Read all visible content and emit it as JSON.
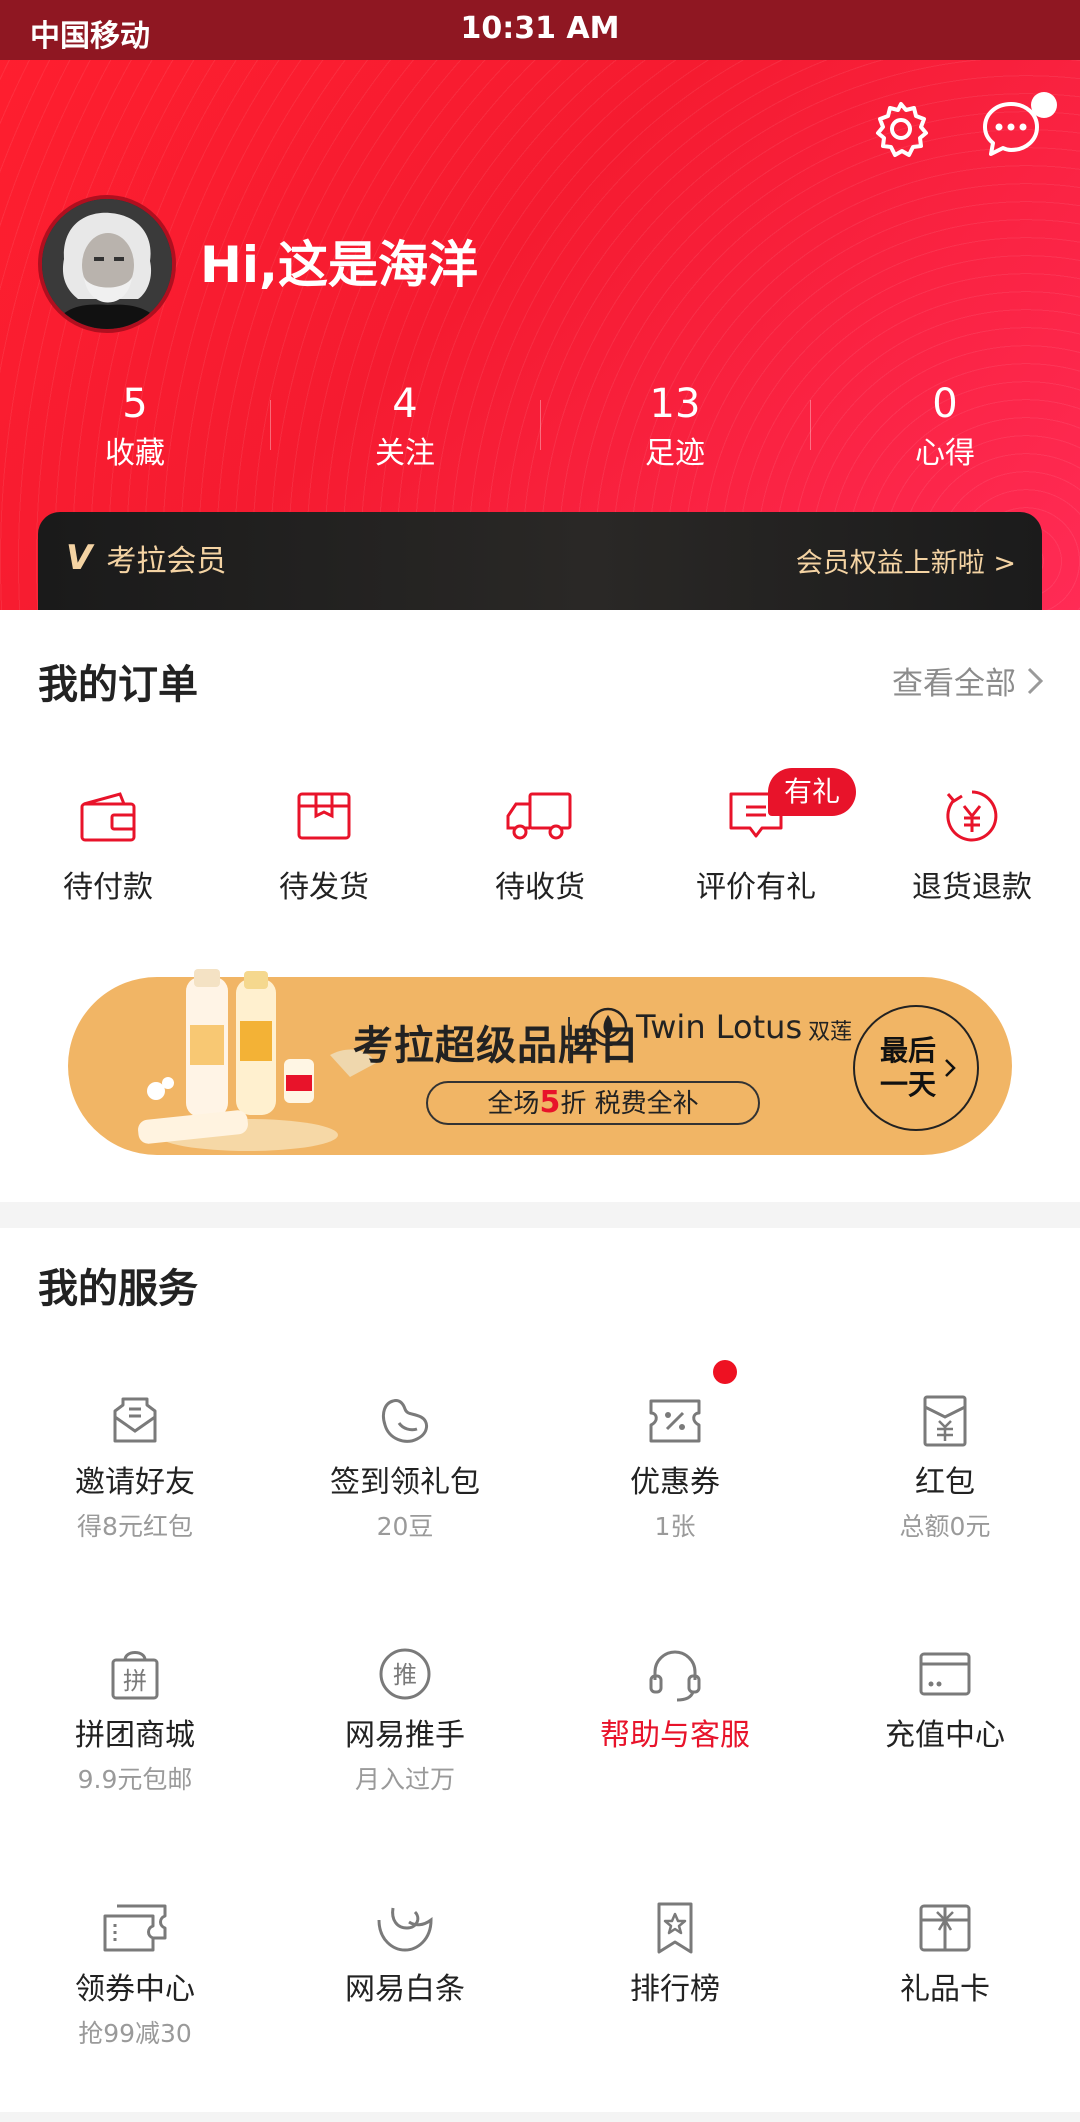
{
  "status_bar": {
    "carrier": "中国移动",
    "time": "10:31 AM"
  },
  "profile": {
    "greeting": "Hi,这是海洋"
  },
  "stats": [
    {
      "value": "5",
      "label": "收藏"
    },
    {
      "value": "4",
      "label": "关注"
    },
    {
      "value": "13",
      "label": "足迹"
    },
    {
      "value": "0",
      "label": "心得"
    }
  ],
  "vip": {
    "title": "考拉会员",
    "link": "会员权益上新啦 >"
  },
  "orders": {
    "title": "我的订单",
    "view_all": "查看全部",
    "badge": "有礼",
    "items": [
      {
        "label": "待付款",
        "icon": "wallet-icon"
      },
      {
        "label": "待发货",
        "icon": "box-icon"
      },
      {
        "label": "待收货",
        "icon": "truck-icon"
      },
      {
        "label": "评价有礼",
        "icon": "comment-icon"
      },
      {
        "label": "退货退款",
        "icon": "refund-icon"
      }
    ]
  },
  "banner": {
    "title": "考拉超级品牌日",
    "brand_en": "Twin Lotus",
    "brand_cn": "双莲",
    "pill_pre": "全场",
    "pill_num": "5",
    "pill_post": "折 税费全补",
    "cta": "最后一天"
  },
  "services": {
    "title": "我的服务",
    "items": [
      {
        "name": "邀请好友",
        "sub": "得8元红包",
        "icon": "envelope-icon"
      },
      {
        "name": "签到领礼包",
        "sub": "20豆",
        "icon": "bean-icon"
      },
      {
        "name": "优惠券",
        "sub": "1张",
        "icon": "coupon-icon"
      },
      {
        "name": "红包",
        "sub": "总额0元",
        "icon": "red-packet-icon"
      },
      {
        "name": "拼团商城",
        "sub": "9.9元包邮",
        "icon": "group-bag-icon"
      },
      {
        "name": "网易推手",
        "sub": "月入过万",
        "icon": "promoter-icon"
      },
      {
        "name": "帮助与客服",
        "sub": "",
        "icon": "headset-icon"
      },
      {
        "name": "充值中心",
        "sub": "",
        "icon": "card-icon"
      },
      {
        "name": "领券中心",
        "sub": "抢99减30",
        "icon": "tickets-icon"
      },
      {
        "name": "网易白条",
        "sub": "",
        "icon": "iou-icon"
      },
      {
        "name": "排行榜",
        "sub": "",
        "icon": "ranking-icon"
      },
      {
        "name": "礼品卡",
        "sub": "",
        "icon": "gift-card-icon"
      }
    ]
  },
  "colors": {
    "brand_red": "#e8132a",
    "gold": "#f4d3a3",
    "banner_orange": "#f1b565"
  }
}
